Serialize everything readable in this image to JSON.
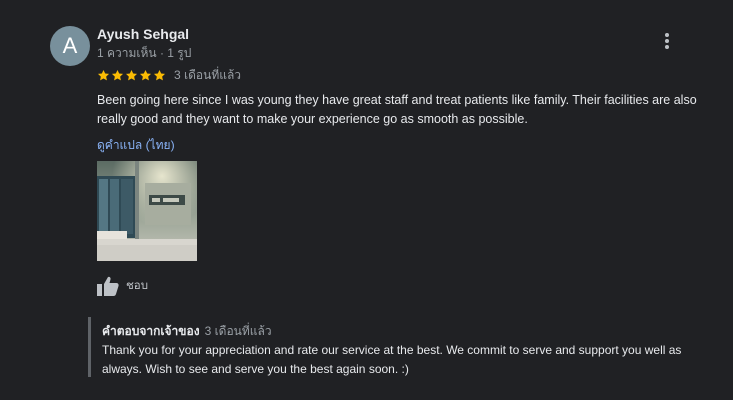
{
  "review": {
    "reviewer": {
      "avatar_letter": "A",
      "name": "Ayush Sehgal",
      "meta": "1 ความเห็น · 1 รูป"
    },
    "rating": 5,
    "rating_max": 5,
    "date": "3 เดือนที่แล้ว",
    "text": "Been going here since I was young they have great staff and treat patients like family. Their facilities are also really good and they want to make your experience go as smooth as possible.",
    "translate_label": "ดูคำแปล (ไทย)",
    "like_label": "ชอบ",
    "icons": {
      "more": "more-vert-icon",
      "star": "star-icon",
      "like": "thumbs-up-icon"
    }
  },
  "owner_response": {
    "title": "คำตอบจากเจ้าของ",
    "date": "3 เดือนที่แล้ว",
    "text": "Thank you for your appreciation and rate our service at the best. We commit to serve and support you well as always. Wish to see and serve you the best again soon. :)"
  },
  "colors": {
    "background": "#202124",
    "star": "#fbbc04",
    "link": "#8ab4f8",
    "avatar": "#78909c"
  }
}
